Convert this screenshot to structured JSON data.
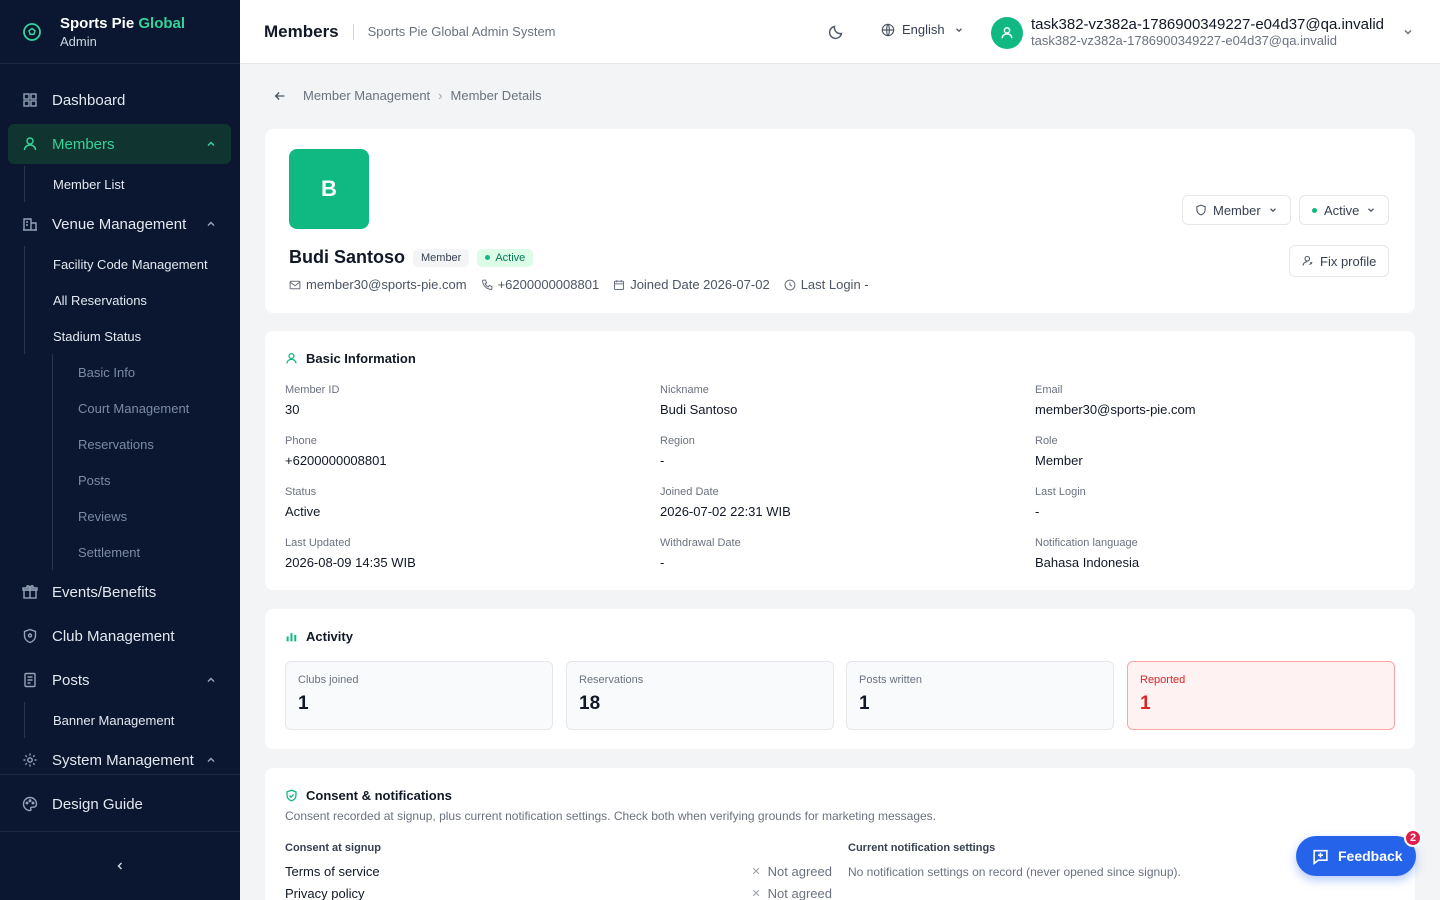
{
  "brand": {
    "name_part1": "Sports Pie ",
    "name_part2": "Global",
    "role": "Admin"
  },
  "sidebar": {
    "dashboard": "Dashboard",
    "members": "Members",
    "member_list": "Member List",
    "venue": "Venue Management",
    "facility_code": "Facility Code Management",
    "all_reservations": "All Reservations",
    "stadium_status": "Stadium Status",
    "stadium_sub": [
      "Basic Info",
      "Court Management",
      "Reservations",
      "Posts",
      "Reviews",
      "Settlement"
    ],
    "events": "Events/Benefits",
    "club": "Club Management",
    "posts": "Posts",
    "banner": "Banner Management",
    "system": "System Management",
    "design_guide": "Design Guide"
  },
  "header": {
    "title": "Members",
    "subtitle": "Sports Pie Global Admin System",
    "language": "English",
    "user_name": "task382-vz382a-1786900349227-e04d37@qa.invalid",
    "user_email": "task382-vz382a-1786900349227-e04d37@qa.invalid"
  },
  "breadcrumb": {
    "parent": "Member Management",
    "current": "Member Details"
  },
  "profile": {
    "initial": "B",
    "name": "Budi Santoso",
    "role_badge": "Member",
    "status_badge": "Active",
    "email": "member30@sports-pie.com",
    "phone": "+6200000008801",
    "joined": "Joined Date 2026-07-02",
    "last_login": "Last Login -",
    "role_select": "Member",
    "status_select": "Active",
    "fix_profile": "Fix profile"
  },
  "basic": {
    "title": "Basic Information",
    "fields": [
      {
        "label": "Member ID",
        "value": "30"
      },
      {
        "label": "Nickname",
        "value": "Budi Santoso"
      },
      {
        "label": "Email",
        "value": "member30@sports-pie.com"
      },
      {
        "label": "Phone",
        "value": "+6200000008801"
      },
      {
        "label": "Region",
        "value": "-"
      },
      {
        "label": "Role",
        "value": "Member"
      },
      {
        "label": "Status",
        "value": "Active"
      },
      {
        "label": "Joined Date",
        "value": "2026-07-02 22:31 WIB"
      },
      {
        "label": "Last Login",
        "value": "-"
      },
      {
        "label": "Last Updated",
        "value": "2026-08-09 14:35 WIB"
      },
      {
        "label": "Withdrawal Date",
        "value": "-"
      },
      {
        "label": "Notification language",
        "value": "Bahasa Indonesia"
      }
    ]
  },
  "activity": {
    "title": "Activity",
    "stats": [
      {
        "label": "Clubs joined",
        "value": "1"
      },
      {
        "label": "Reservations",
        "value": "18"
      },
      {
        "label": "Posts written",
        "value": "1"
      },
      {
        "label": "Reported",
        "value": "1"
      }
    ]
  },
  "consent": {
    "title": "Consent & notifications",
    "description": "Consent recorded at signup, plus current notification settings. Check both when verifying grounds for marketing messages.",
    "signup_heading": "Consent at signup",
    "current_heading": "Current notification settings",
    "items": [
      {
        "label": "Terms of service",
        "value": "Not agreed"
      },
      {
        "label": "Privacy policy",
        "value": "Not agreed"
      }
    ],
    "current_note": "No notification settings on record (never opened since signup)."
  },
  "feedback": {
    "label": "Feedback",
    "count": "2"
  },
  "colors": {
    "accent": "#10b981",
    "sidebar_bg": "#0b1730",
    "feedback": "#2563eb",
    "danger": "#dc2626"
  }
}
